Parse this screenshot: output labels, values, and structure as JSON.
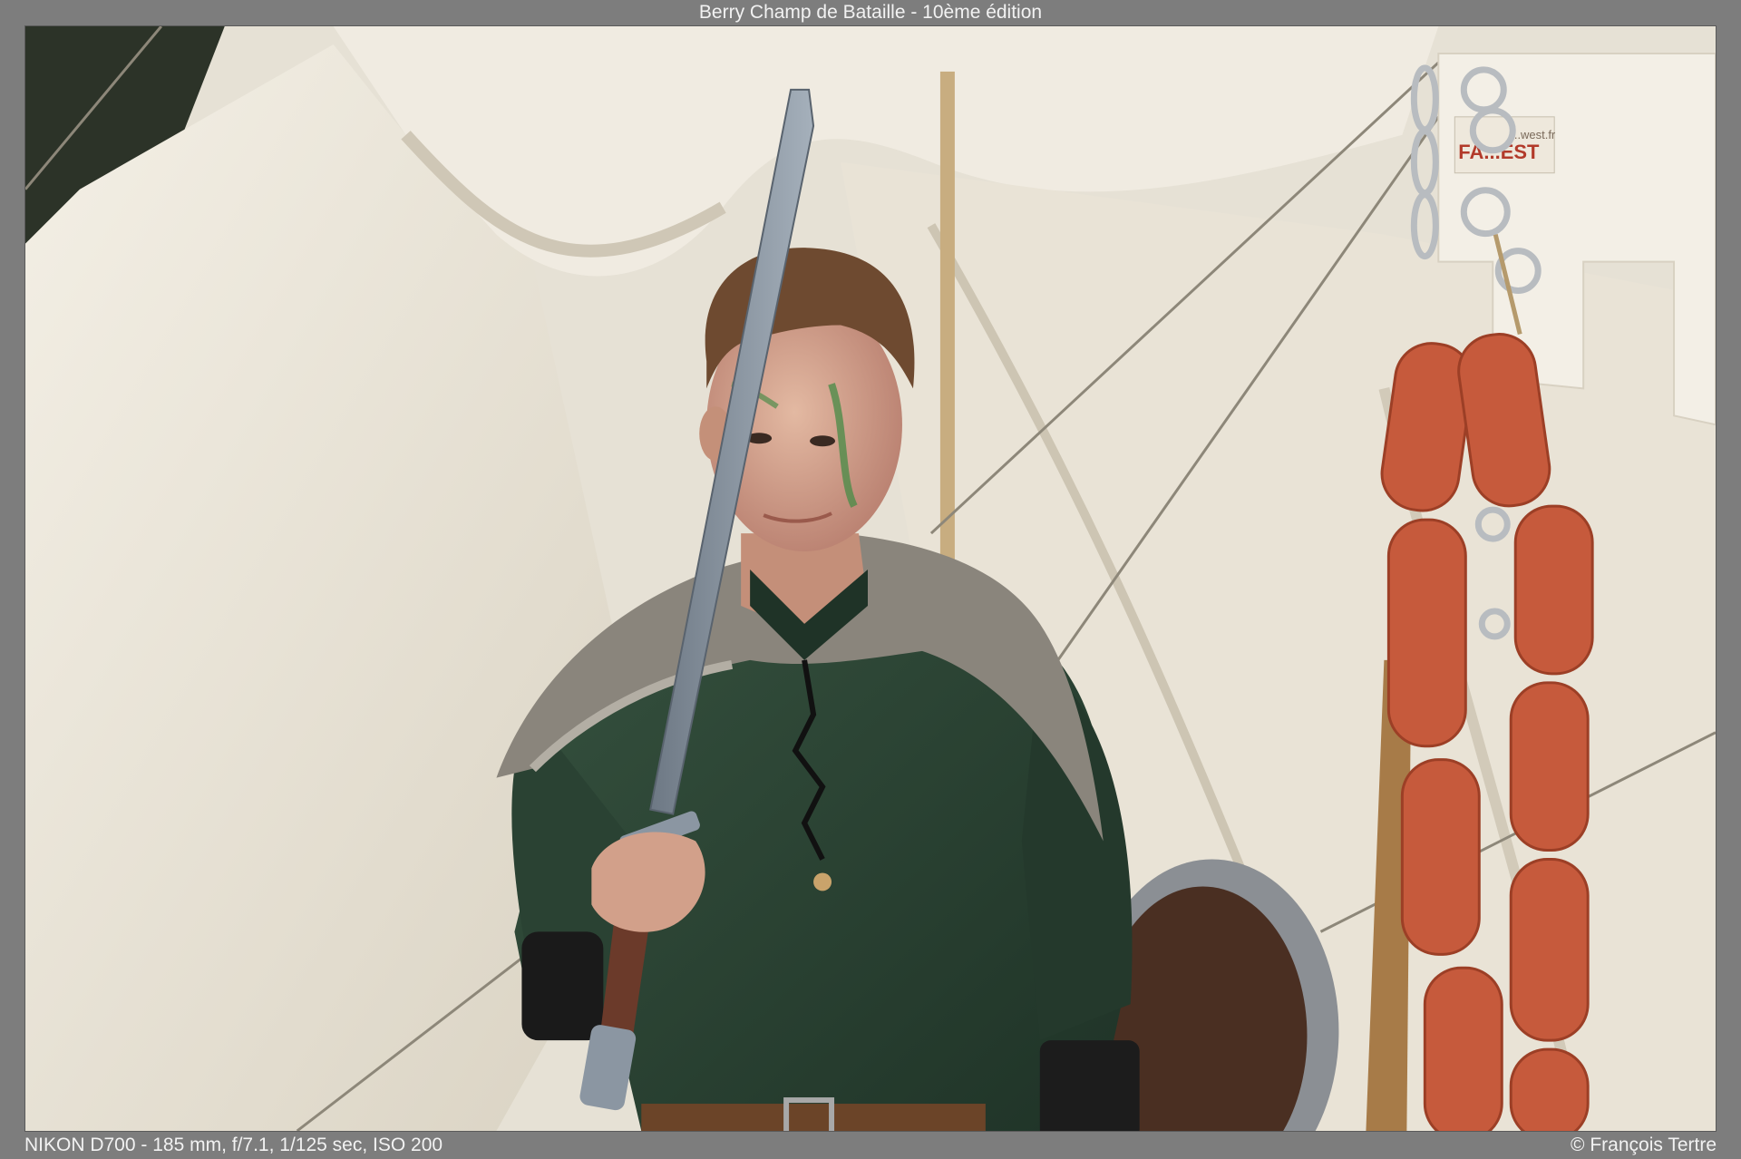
{
  "frame": {
    "title": "Berry Champ de Bataille - 10ème édition",
    "exif": "NIKON D700 - 185 mm, f/7.1, 1/125 sec, ISO 200",
    "credit": "© François Tertre"
  },
  "photo": {
    "subject": "young man in medieval costume holding a wooden sword, fur mantle, green tunic, white tents and hanging sausages in background",
    "palette": {
      "tent": "#ece7db",
      "tent_shadow": "#c9c2b2",
      "tunic": "#2d4535",
      "fur": "#8a857c",
      "sword": "#7f8c99",
      "skin": "#d6a58c",
      "hair": "#6e4a30",
      "sausage": "#c65a3c",
      "frame": "#7d7d7d"
    },
    "icons": [
      "sword",
      "shield",
      "sausage-string",
      "chain",
      "tent-pole"
    ],
    "sign_fragment": "FA...EST",
    "sign_fragment_top": "...west.fr"
  }
}
